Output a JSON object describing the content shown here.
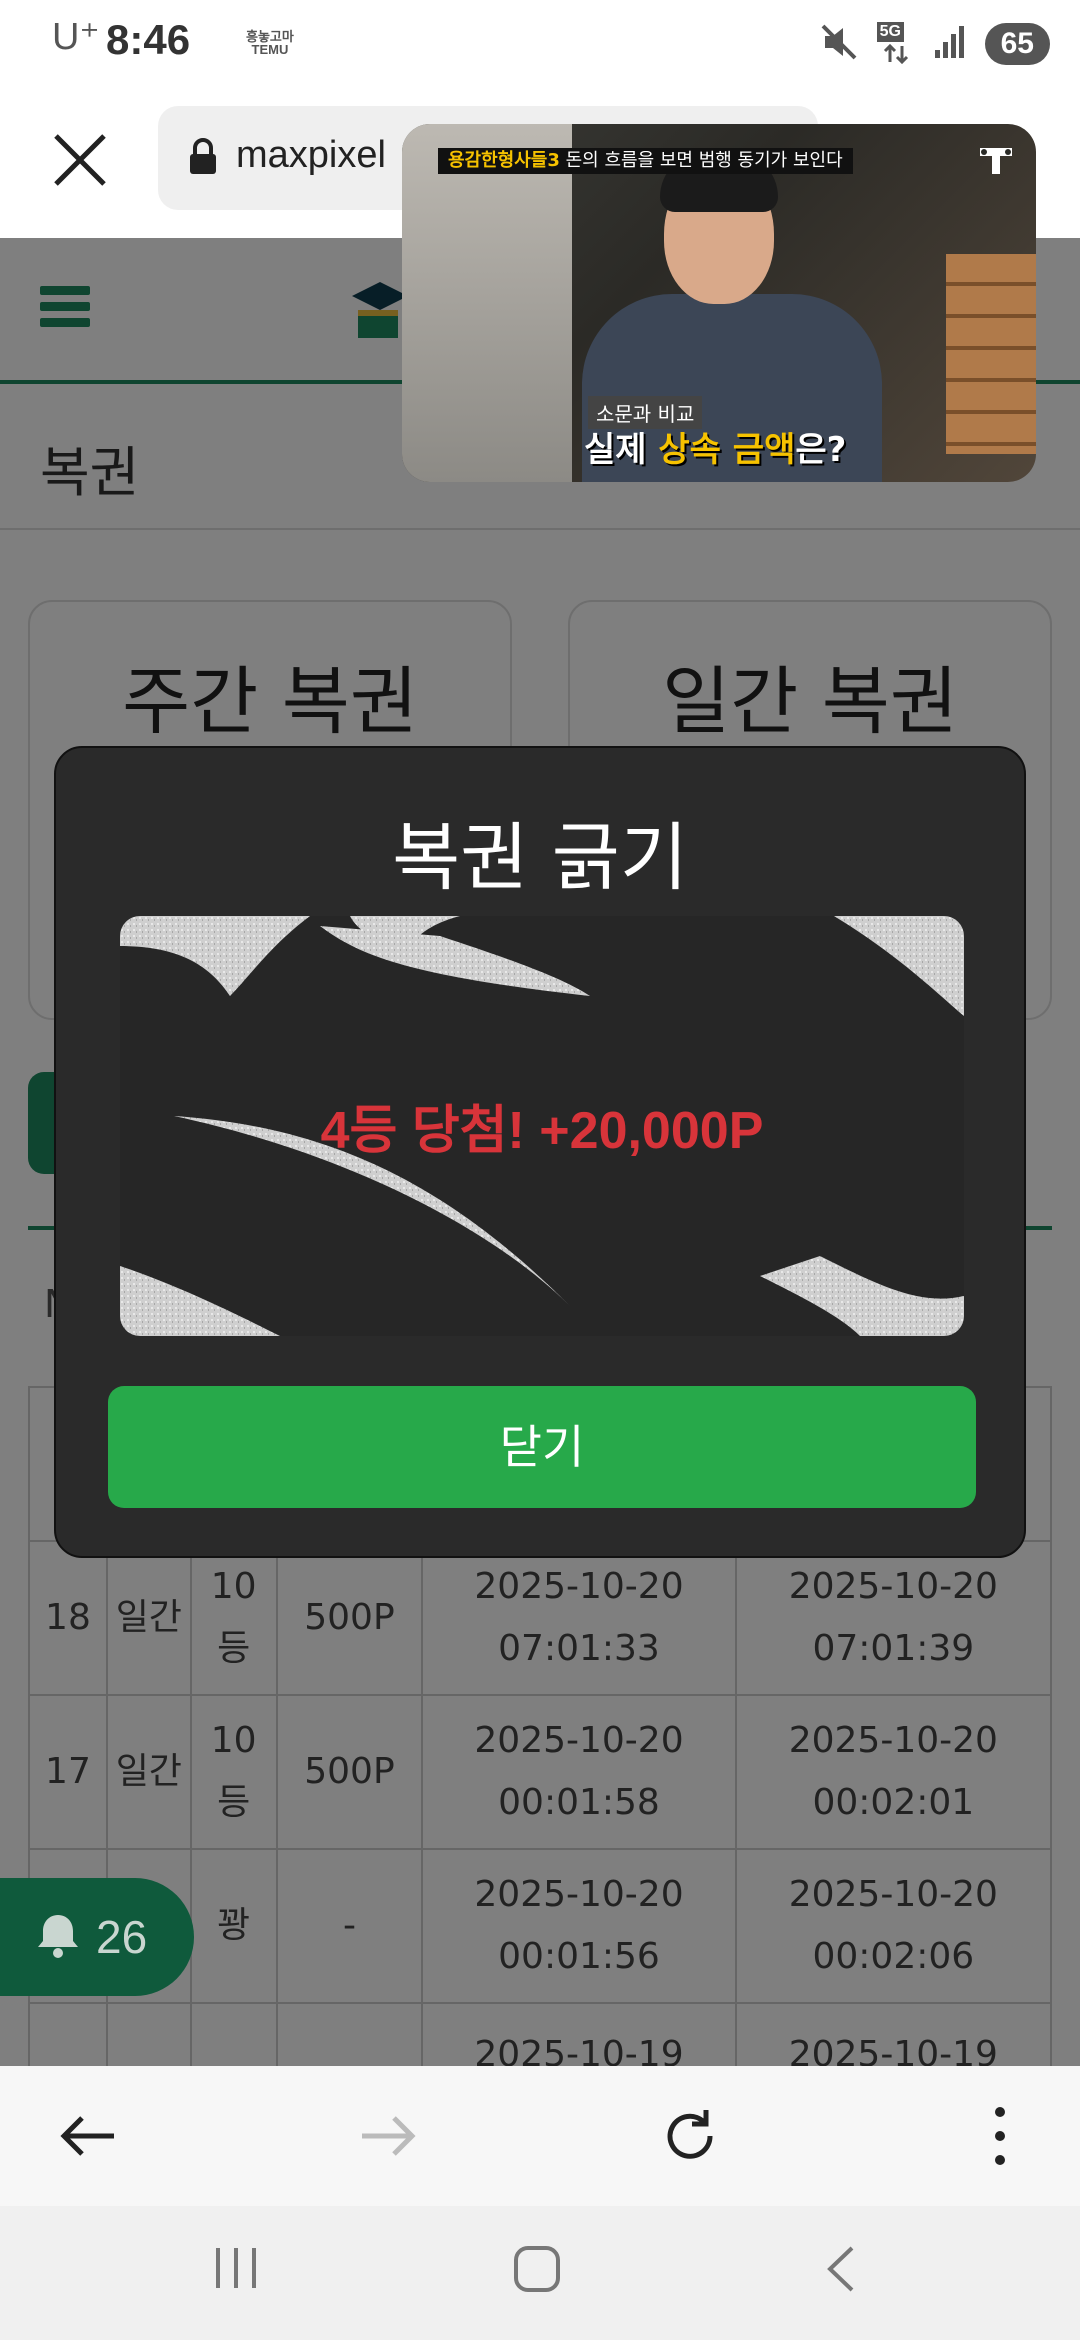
{
  "status_bar": {
    "carrier": "U⁺",
    "time": "8:46",
    "temu_badge": "TEMU",
    "network": "5G",
    "battery": "65",
    "icons": [
      "mute-icon",
      "signal-icon"
    ]
  },
  "browser": {
    "url": "maxpixel",
    "icons": [
      "close-icon",
      "lock-icon"
    ]
  },
  "pip_video": {
    "top_banner_title": "용감한형사들3",
    "top_banner_text": "돈의 흐름을 보면 범행 동기가 보인다",
    "caption_small": "소문과 비교",
    "caption_main_before": "실제 ",
    "caption_main_highlight": "상속 금액",
    "caption_main_after": "은?"
  },
  "site": {
    "page_title": "복권",
    "weekly_card_title": "주간 복권",
    "daily_card_title": "일간 복권",
    "table_partial_header": "N",
    "rows": [
      {
        "no": "18",
        "type": "일간",
        "rank": "10\n등",
        "points": "500P",
        "issued": "2025-10-20\n07:01:33",
        "scratched": "2025-10-20\n07:01:39"
      },
      {
        "no": "17",
        "type": "일간",
        "rank": "10\n등",
        "points": "500P",
        "issued": "2025-10-20\n00:01:58",
        "scratched": "2025-10-20\n00:02:01"
      },
      {
        "no": "",
        "type": "",
        "rank": "꽝",
        "points": "-",
        "issued": "2025-10-20\n00:01:56",
        "scratched": "2025-10-20\n00:02:06"
      },
      {
        "no": "",
        "type": "",
        "rank": "",
        "points": "",
        "issued": "2025-10-19",
        "scratched": "2025-10-19"
      }
    ],
    "notification_count": "26"
  },
  "modal": {
    "title": "복권 긁기",
    "prize_text": "4등 당첨! +20,000P",
    "close_button": "닫기"
  },
  "colors": {
    "brand_green": "#1e8a60",
    "button_green": "#27a94a",
    "prize_red": "#d8343a",
    "modal_bg": "#2a2a2a"
  }
}
